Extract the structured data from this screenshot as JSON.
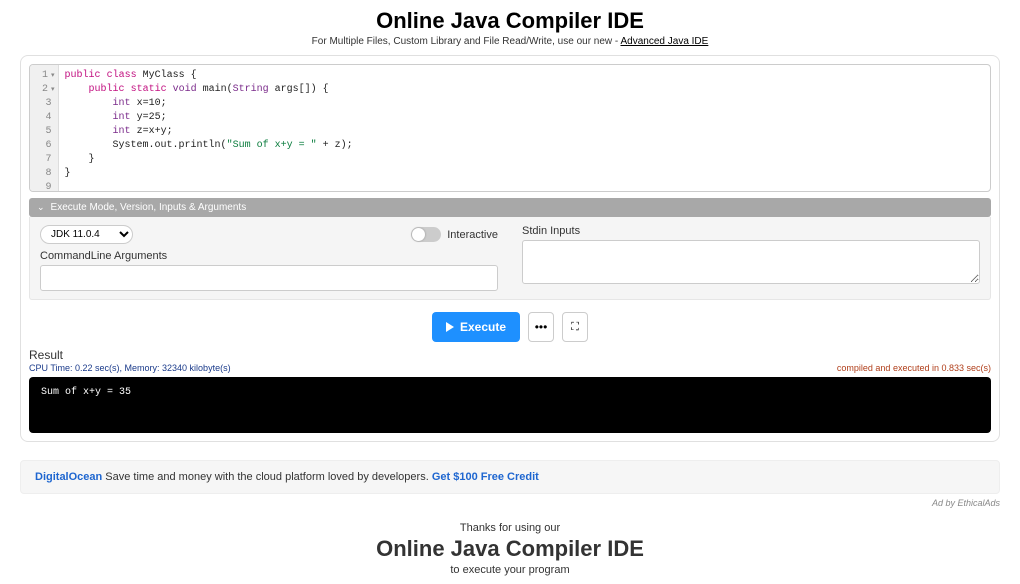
{
  "header": {
    "title": "Online Java Compiler IDE",
    "subtitle_prefix": "For Multiple Files, Custom Library and File Read/Write, use our new - ",
    "subtitle_link": "Advanced Java IDE"
  },
  "editor": {
    "line_numbers": [
      "1",
      "2",
      "3",
      "4",
      "5",
      "6",
      "7",
      "8",
      "9"
    ],
    "code_lines": [
      [
        {
          "c": "kw",
          "t": "public"
        },
        {
          "c": "txt",
          "t": " "
        },
        {
          "c": "kw",
          "t": "class"
        },
        {
          "c": "txt",
          "t": " MyClass {"
        }
      ],
      [
        {
          "c": "txt",
          "t": "    "
        },
        {
          "c": "kw",
          "t": "public"
        },
        {
          "c": "txt",
          "t": " "
        },
        {
          "c": "kw",
          "t": "static"
        },
        {
          "c": "txt",
          "t": " "
        },
        {
          "c": "type",
          "t": "void"
        },
        {
          "c": "txt",
          "t": " main("
        },
        {
          "c": "type",
          "t": "String"
        },
        {
          "c": "txt",
          "t": " args[]) {"
        }
      ],
      [
        {
          "c": "txt",
          "t": "        "
        },
        {
          "c": "type",
          "t": "int"
        },
        {
          "c": "txt",
          "t": " x=10;"
        }
      ],
      [
        {
          "c": "txt",
          "t": "        "
        },
        {
          "c": "type",
          "t": "int"
        },
        {
          "c": "txt",
          "t": " y=25;"
        }
      ],
      [
        {
          "c": "txt",
          "t": "        "
        },
        {
          "c": "type",
          "t": "int"
        },
        {
          "c": "txt",
          "t": " z=x+y;"
        }
      ],
      [
        {
          "c": "txt",
          "t": ""
        }
      ],
      [
        {
          "c": "txt",
          "t": "        System.out.println("
        },
        {
          "c": "str",
          "t": "\"Sum of x+y = \""
        },
        {
          "c": "txt",
          "t": " + z);"
        }
      ],
      [
        {
          "c": "txt",
          "t": "    }"
        }
      ],
      [
        {
          "c": "txt",
          "t": "}"
        }
      ]
    ]
  },
  "section_bar": {
    "title": "Execute Mode, Version, Inputs & Arguments"
  },
  "options": {
    "version_selected": "JDK 11.0.4",
    "interactive_label": "Interactive",
    "cmdline_label": "CommandLine Arguments",
    "cmdline_value": "",
    "stdin_label": "Stdin Inputs",
    "stdin_value": ""
  },
  "buttons": {
    "execute": "Execute",
    "more": "•••"
  },
  "result": {
    "heading": "Result",
    "stats_left": "CPU Time: 0.22 sec(s), Memory: 32340 kilobyte(s)",
    "stats_right": "compiled and executed in 0.833 sec(s)",
    "output": "Sum of x+y = 35"
  },
  "ad": {
    "brand": "DigitalOcean",
    "text": " Save time and money with the cloud platform loved by developers. ",
    "cta": "Get $100 Free Credit",
    "by": "Ad by EthicalAds"
  },
  "footer": {
    "line1": "Thanks for using our",
    "title": "Online Java Compiler IDE",
    "line2": "to execute your program"
  }
}
